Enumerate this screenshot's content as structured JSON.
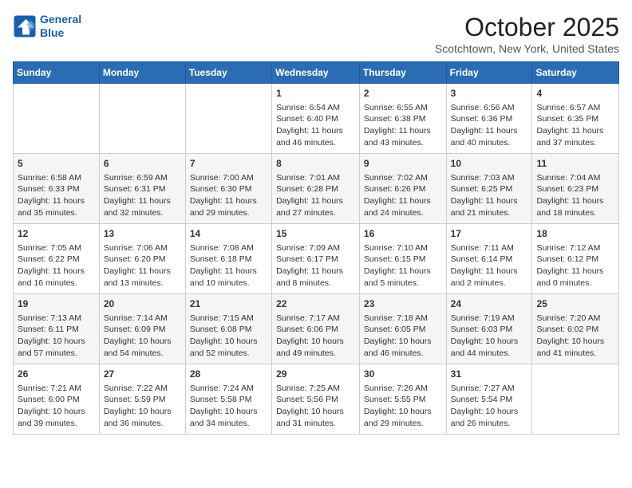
{
  "logo": {
    "line1": "General",
    "line2": "Blue"
  },
  "header": {
    "month": "October 2025",
    "location": "Scotchtown, New York, United States"
  },
  "weekdays": [
    "Sunday",
    "Monday",
    "Tuesday",
    "Wednesday",
    "Thursday",
    "Friday",
    "Saturday"
  ],
  "weeks": [
    [
      {
        "day": "",
        "info": ""
      },
      {
        "day": "",
        "info": ""
      },
      {
        "day": "",
        "info": ""
      },
      {
        "day": "1",
        "info": "Sunrise: 6:54 AM\nSunset: 6:40 PM\nDaylight: 11 hours\nand 46 minutes."
      },
      {
        "day": "2",
        "info": "Sunrise: 6:55 AM\nSunset: 6:38 PM\nDaylight: 11 hours\nand 43 minutes."
      },
      {
        "day": "3",
        "info": "Sunrise: 6:56 AM\nSunset: 6:36 PM\nDaylight: 11 hours\nand 40 minutes."
      },
      {
        "day": "4",
        "info": "Sunrise: 6:57 AM\nSunset: 6:35 PM\nDaylight: 11 hours\nand 37 minutes."
      }
    ],
    [
      {
        "day": "5",
        "info": "Sunrise: 6:58 AM\nSunset: 6:33 PM\nDaylight: 11 hours\nand 35 minutes."
      },
      {
        "day": "6",
        "info": "Sunrise: 6:59 AM\nSunset: 6:31 PM\nDaylight: 11 hours\nand 32 minutes."
      },
      {
        "day": "7",
        "info": "Sunrise: 7:00 AM\nSunset: 6:30 PM\nDaylight: 11 hours\nand 29 minutes."
      },
      {
        "day": "8",
        "info": "Sunrise: 7:01 AM\nSunset: 6:28 PM\nDaylight: 11 hours\nand 27 minutes."
      },
      {
        "day": "9",
        "info": "Sunrise: 7:02 AM\nSunset: 6:26 PM\nDaylight: 11 hours\nand 24 minutes."
      },
      {
        "day": "10",
        "info": "Sunrise: 7:03 AM\nSunset: 6:25 PM\nDaylight: 11 hours\nand 21 minutes."
      },
      {
        "day": "11",
        "info": "Sunrise: 7:04 AM\nSunset: 6:23 PM\nDaylight: 11 hours\nand 18 minutes."
      }
    ],
    [
      {
        "day": "12",
        "info": "Sunrise: 7:05 AM\nSunset: 6:22 PM\nDaylight: 11 hours\nand 16 minutes."
      },
      {
        "day": "13",
        "info": "Sunrise: 7:06 AM\nSunset: 6:20 PM\nDaylight: 11 hours\nand 13 minutes."
      },
      {
        "day": "14",
        "info": "Sunrise: 7:08 AM\nSunset: 6:18 PM\nDaylight: 11 hours\nand 10 minutes."
      },
      {
        "day": "15",
        "info": "Sunrise: 7:09 AM\nSunset: 6:17 PM\nDaylight: 11 hours\nand 8 minutes."
      },
      {
        "day": "16",
        "info": "Sunrise: 7:10 AM\nSunset: 6:15 PM\nDaylight: 11 hours\nand 5 minutes."
      },
      {
        "day": "17",
        "info": "Sunrise: 7:11 AM\nSunset: 6:14 PM\nDaylight: 11 hours\nand 2 minutes."
      },
      {
        "day": "18",
        "info": "Sunrise: 7:12 AM\nSunset: 6:12 PM\nDaylight: 11 hours\nand 0 minutes."
      }
    ],
    [
      {
        "day": "19",
        "info": "Sunrise: 7:13 AM\nSunset: 6:11 PM\nDaylight: 10 hours\nand 57 minutes."
      },
      {
        "day": "20",
        "info": "Sunrise: 7:14 AM\nSunset: 6:09 PM\nDaylight: 10 hours\nand 54 minutes."
      },
      {
        "day": "21",
        "info": "Sunrise: 7:15 AM\nSunset: 6:08 PM\nDaylight: 10 hours\nand 52 minutes."
      },
      {
        "day": "22",
        "info": "Sunrise: 7:17 AM\nSunset: 6:06 PM\nDaylight: 10 hours\nand 49 minutes."
      },
      {
        "day": "23",
        "info": "Sunrise: 7:18 AM\nSunset: 6:05 PM\nDaylight: 10 hours\nand 46 minutes."
      },
      {
        "day": "24",
        "info": "Sunrise: 7:19 AM\nSunset: 6:03 PM\nDaylight: 10 hours\nand 44 minutes."
      },
      {
        "day": "25",
        "info": "Sunrise: 7:20 AM\nSunset: 6:02 PM\nDaylight: 10 hours\nand 41 minutes."
      }
    ],
    [
      {
        "day": "26",
        "info": "Sunrise: 7:21 AM\nSunset: 6:00 PM\nDaylight: 10 hours\nand 39 minutes."
      },
      {
        "day": "27",
        "info": "Sunrise: 7:22 AM\nSunset: 5:59 PM\nDaylight: 10 hours\nand 36 minutes."
      },
      {
        "day": "28",
        "info": "Sunrise: 7:24 AM\nSunset: 5:58 PM\nDaylight: 10 hours\nand 34 minutes."
      },
      {
        "day": "29",
        "info": "Sunrise: 7:25 AM\nSunset: 5:56 PM\nDaylight: 10 hours\nand 31 minutes."
      },
      {
        "day": "30",
        "info": "Sunrise: 7:26 AM\nSunset: 5:55 PM\nDaylight: 10 hours\nand 29 minutes."
      },
      {
        "day": "31",
        "info": "Sunrise: 7:27 AM\nSunset: 5:54 PM\nDaylight: 10 hours\nand 26 minutes."
      },
      {
        "day": "",
        "info": ""
      }
    ]
  ]
}
